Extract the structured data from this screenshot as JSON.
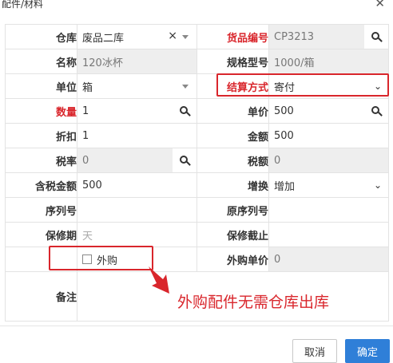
{
  "dialog": {
    "title": "配件/材料",
    "close_icon": "close-icon"
  },
  "rows": {
    "warehouse": {
      "label": "仓库",
      "value": "废品二库"
    },
    "item_code": {
      "label": "货品编号",
      "value": "CP3213"
    },
    "name": {
      "label": "名称",
      "value": "120冰杯"
    },
    "spec": {
      "label": "规格型号",
      "value": "1000/箱"
    },
    "unit": {
      "label": "单位",
      "value": "箱"
    },
    "settlement": {
      "label": "结算方式",
      "value": "寄付"
    },
    "quantity": {
      "label": "数量",
      "value": "1"
    },
    "unit_price": {
      "label": "单价",
      "value": "500"
    },
    "discount": {
      "label": "折扣",
      "value": "1"
    },
    "amount": {
      "label": "金额",
      "value": "500"
    },
    "tax_rate": {
      "label": "税率",
      "value": "0"
    },
    "tax_amount": {
      "label": "税额",
      "value": "0"
    },
    "amount_incl_tax": {
      "label": "含税金额",
      "value": "500"
    },
    "exchange": {
      "label": "增换",
      "value": "增加"
    },
    "serial": {
      "label": "序列号",
      "value": ""
    },
    "orig_serial": {
      "label": "原序列号",
      "value": ""
    },
    "warranty": {
      "label": "保修期",
      "placeholder": "天"
    },
    "warranty_end": {
      "label": "保修截止",
      "value": ""
    },
    "outsource": {
      "label": "外购",
      "checked": false
    },
    "outsource_price": {
      "label": "外购单价",
      "value": "0"
    },
    "remark": {
      "label": "备注",
      "value": ""
    }
  },
  "annotation": {
    "text": "外购配件无需仓库出库",
    "color": "#d9262c"
  },
  "footer": {
    "cancel_label": "取消",
    "ok_label": "确定"
  },
  "colors": {
    "accent": "#2f7fd8",
    "required": "#d9262c",
    "readonly_bg": "#eeeeee"
  }
}
